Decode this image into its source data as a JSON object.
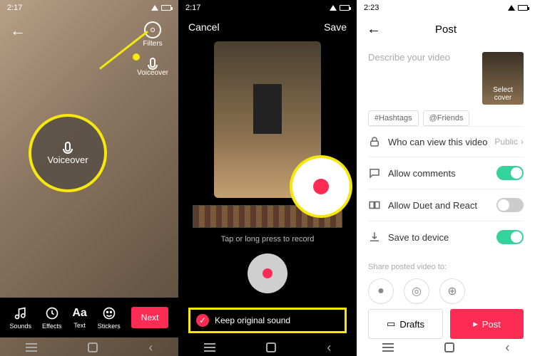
{
  "phone1": {
    "status_time": "2:17",
    "side": {
      "filters": "Filters",
      "voiceover": "Voiceover"
    },
    "callout_label": "Voiceover",
    "toolbar": {
      "sounds": "Sounds",
      "effects": "Effects",
      "text": "Text",
      "stickers": "Stickers",
      "next": "Next"
    }
  },
  "phone2": {
    "status_time": "2:17",
    "cancel": "Cancel",
    "save": "Save",
    "instruction": "Tap or long press to record",
    "keep_sound": "Keep original sound"
  },
  "phone3": {
    "status_time": "2:23",
    "title": "Post",
    "describe_placeholder": "Describe your video",
    "cover_label": "Select cover",
    "chips": {
      "hashtags": "#Hashtags",
      "friends": "@Friends"
    },
    "opts": {
      "who": "Who can view this video",
      "who_value": "Public",
      "comments": "Allow comments",
      "duet": "Allow Duet and React",
      "save": "Save to device"
    },
    "share_label": "Share posted video to:",
    "drafts": "Drafts",
    "post": "Post"
  }
}
